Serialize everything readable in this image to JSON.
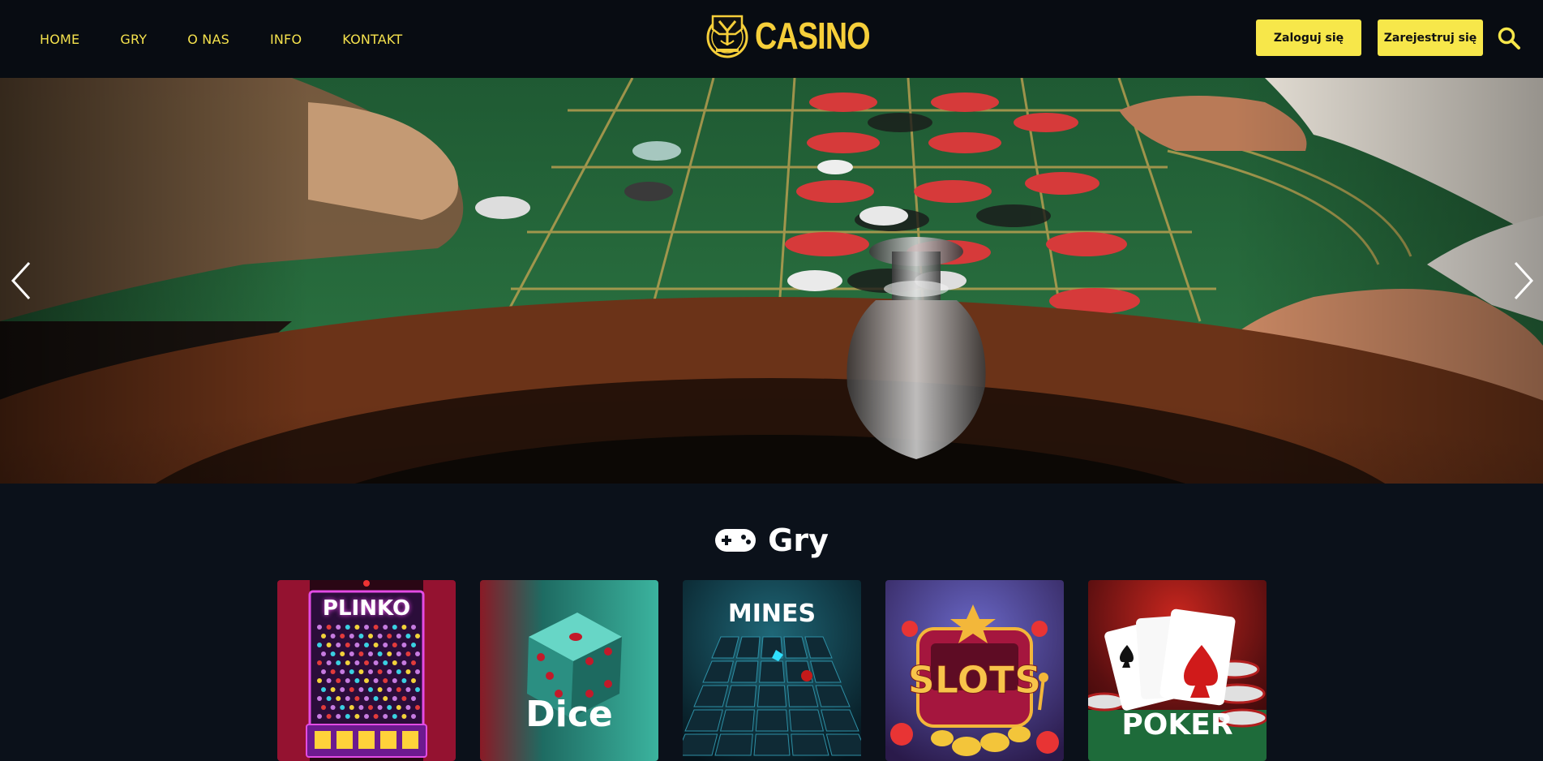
{
  "header": {
    "nav": [
      {
        "label": "HOME"
      },
      {
        "label": "GRY"
      },
      {
        "label": "O NAS"
      },
      {
        "label": "INFO"
      },
      {
        "label": "KONTAKT"
      }
    ],
    "logo_text": "CASINO",
    "login_label": "Zaloguj się",
    "register_label": "Zarejestruj się",
    "search_icon": "search-icon"
  },
  "hero": {
    "prev_icon": "chevron-left-icon",
    "next_icon": "chevron-right-icon"
  },
  "games": {
    "section_icon": "gamepad-icon",
    "title": "Gry",
    "items": [
      {
        "label": "PLINKO"
      },
      {
        "label": "Dice"
      },
      {
        "label": "MINES"
      },
      {
        "label": "SLOTS"
      },
      {
        "label": "POKER"
      }
    ]
  },
  "colors": {
    "accent": "#f7e74a",
    "nav_text": "#f5e24d",
    "header_bg": "#080c12",
    "page_bg": "#0b111a"
  }
}
